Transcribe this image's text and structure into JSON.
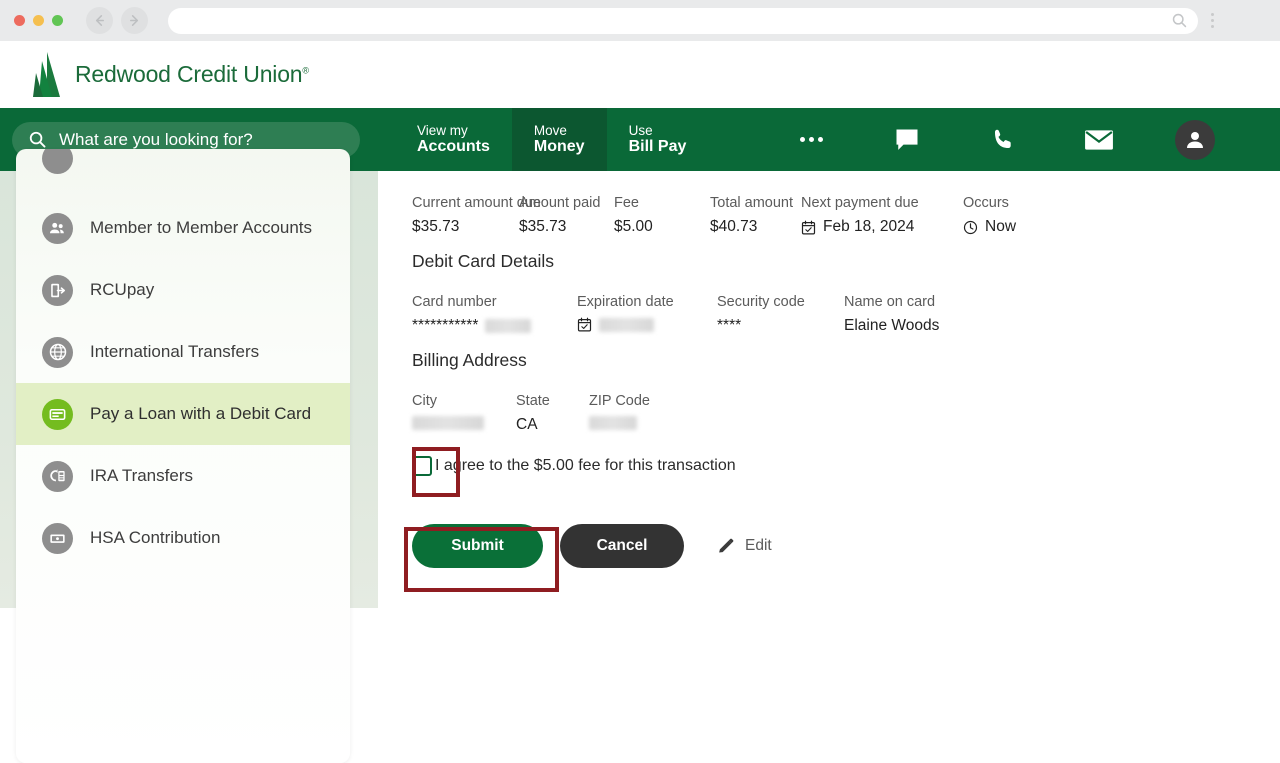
{
  "browser": {
    "back_icon": "arrow-left-icon",
    "forward_icon": "arrow-right-icon",
    "url_value": "",
    "url_search_icon": "search-icon",
    "menu_icon": "kebab-menu-icon"
  },
  "header": {
    "brand_name": "Redwood Credit Union",
    "brand_tm": "®",
    "logo_icon": "redwood-trees-logo"
  },
  "navbar": {
    "search": {
      "icon": "search-icon",
      "placeholder": "What are you looking for?",
      "value": "What are you looking for?"
    },
    "tabs": [
      {
        "line1": "View my",
        "line2": "Accounts",
        "active": false
      },
      {
        "line1": "Move",
        "line2": "Money",
        "active": true
      },
      {
        "line1": "Use",
        "line2": "Bill Pay",
        "active": false
      }
    ],
    "icons": [
      "more-dots-icon",
      "chat-icon",
      "phone-icon",
      "mail-icon",
      "account-avatar-icon"
    ],
    "colors": {
      "bar": "#0a6938",
      "active_tab": "#0c5730",
      "search_field": "#2e7e53"
    }
  },
  "sidebar": {
    "items": [
      {
        "label": "",
        "icon": "partial-item-icon",
        "active": false
      },
      {
        "label": "Member to Member Accounts",
        "icon": "people-icon",
        "active": false
      },
      {
        "label": "RCUpay",
        "icon": "rcupay-icon",
        "active": false
      },
      {
        "label": "International Transfers",
        "icon": "globe-icon",
        "active": false
      },
      {
        "label": "Pay a Loan with a Debit Card",
        "icon": "credit-card-icon",
        "active": true
      },
      {
        "label": "IRA Transfers",
        "icon": "ira-transfer-icon",
        "active": false
      },
      {
        "label": "HSA Contribution",
        "icon": "hsa-money-icon",
        "active": false
      }
    ],
    "active_bg": "#e2efc5",
    "active_icon_color": "#74bc1f"
  },
  "main": {
    "summary_fields": [
      {
        "label": "Current amount due",
        "value": "$35.73"
      },
      {
        "label": "Amount paid",
        "value": "$35.73"
      },
      {
        "label": "Fee",
        "value": "$5.00"
      },
      {
        "label": "Total amount",
        "value": "$40.73"
      },
      {
        "label": "Next payment due",
        "value": "Feb 18, 2024",
        "icon": "calendar-icon"
      },
      {
        "label": "Occurs",
        "value": "Now",
        "icon": "clock-icon"
      }
    ],
    "debit_card_section_title": "Debit Card Details",
    "card_fields": [
      {
        "label": "Card number",
        "value": "***********",
        "masked": true
      },
      {
        "label": "Expiration date",
        "value": "",
        "masked": true,
        "icon": "calendar-icon"
      },
      {
        "label": "Security code",
        "value": "****"
      },
      {
        "label": "Name on card",
        "value": "Elaine Woods"
      }
    ],
    "billing_section_title": "Billing Address",
    "billing_fields": [
      {
        "label": "City",
        "value": "",
        "masked": true
      },
      {
        "label": "State",
        "value": "CA"
      },
      {
        "label": "ZIP Code",
        "value": "",
        "masked": true
      }
    ],
    "agreement": {
      "checked": false,
      "label": "I agree to the $5.00 fee for this transaction"
    },
    "actions": {
      "submit_label": "Submit",
      "cancel_label": "Cancel",
      "edit_label": "Edit",
      "edit_icon": "pencil-icon"
    }
  },
  "annotations": {
    "highlight_color": "#8f1d21",
    "targets": [
      "agreement-checkbox",
      "submit-button"
    ]
  }
}
